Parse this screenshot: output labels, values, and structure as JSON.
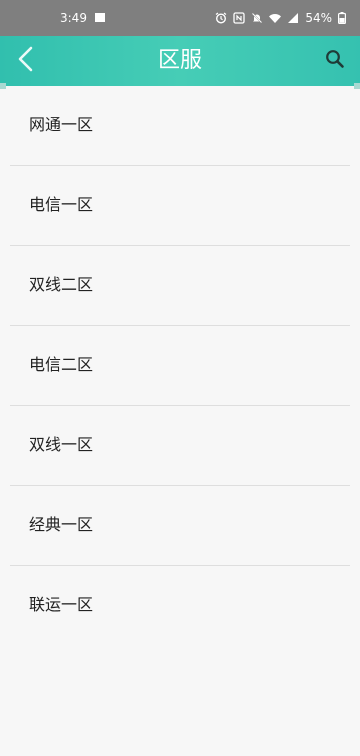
{
  "status_bar": {
    "time": "3:49",
    "battery": "54%"
  },
  "app_bar": {
    "title": "区服"
  },
  "server_list": [
    {
      "label": "网通一区"
    },
    {
      "label": "电信一区"
    },
    {
      "label": "双线二区"
    },
    {
      "label": "电信二区"
    },
    {
      "label": "双线一区"
    },
    {
      "label": "经典一区"
    },
    {
      "label": "联运一区"
    }
  ],
  "colors": {
    "app_bar_accent": "#3cc6b2",
    "status_bar": "#7f7f7f",
    "background": "#f7f7f7",
    "divider": "#dedede"
  }
}
